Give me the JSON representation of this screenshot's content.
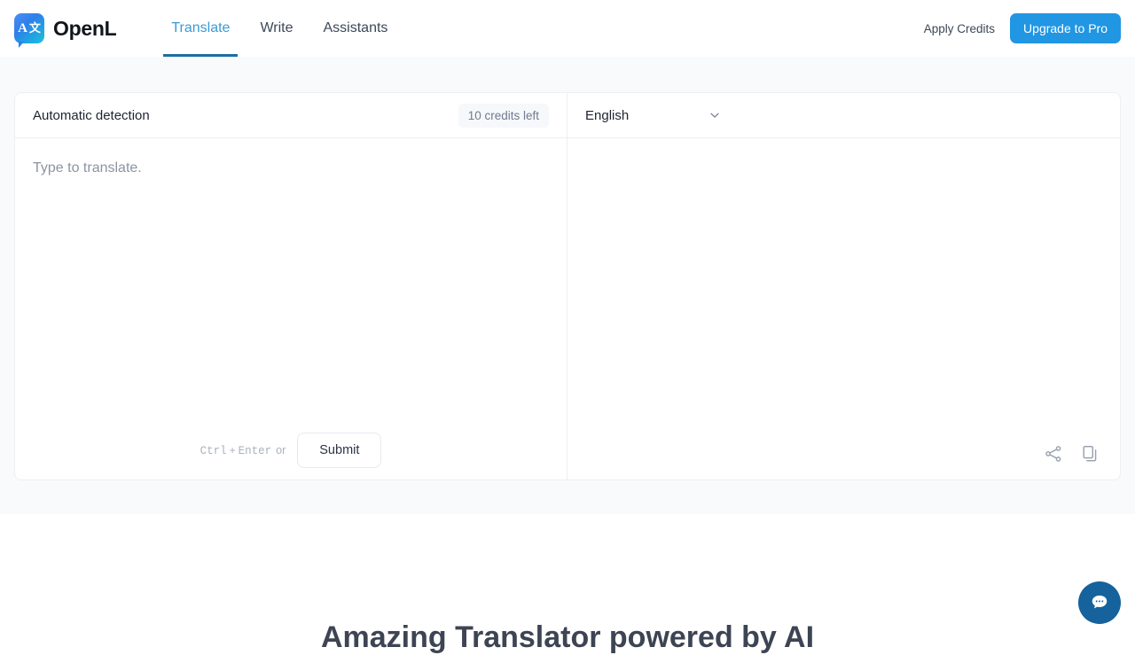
{
  "header": {
    "brand_name": "OpenL",
    "logo_glyph_a": "A",
    "logo_glyph_cjk": "文",
    "nav": [
      {
        "label": "Translate",
        "active": true
      },
      {
        "label": "Write",
        "active": false
      },
      {
        "label": "Assistants",
        "active": false
      }
    ],
    "apply_credits_label": "Apply Credits",
    "upgrade_label": "Upgrade to Pro",
    "accent_color": "#2196e3",
    "active_tab_color": "#3a9ad4",
    "active_underline_color": "#1b6ea3"
  },
  "translator": {
    "source": {
      "language_label": "Automatic detection",
      "credits_badge": "10 credits left",
      "input_value": "",
      "input_placeholder": "Type to translate.",
      "hint_key_1": "Ctrl",
      "hint_plus": "+",
      "hint_key_2": "Enter",
      "hint_or": "or",
      "submit_label": "Submit"
    },
    "target": {
      "language_label": "English",
      "chevron_icon": "chevron-down-icon",
      "output_value": "",
      "share_icon": "share-icon",
      "copy_icon": "copy-icon"
    }
  },
  "hero": {
    "title": "Amazing Translator powered by AI"
  },
  "chat_widget": {
    "icon": "chat-bubble-icon",
    "color": "#15629c"
  }
}
